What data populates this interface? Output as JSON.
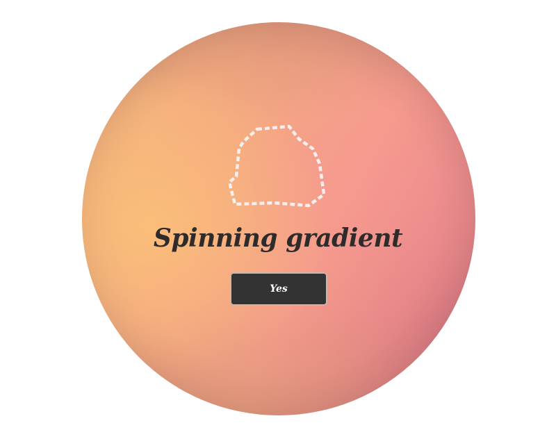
{
  "heading": {
    "text": "Spinning gradient"
  },
  "confirm_button": {
    "label": "Yes"
  },
  "shape": {
    "icon": "dashed-outline-blob-icon",
    "stroke_color": "#f4eeee"
  },
  "theme": {
    "gradient_colors": [
      "#f6b97a",
      "#f4ab80",
      "#f59b8c",
      "#e17f86",
      "#d27684"
    ],
    "button_color": "#333333",
    "text_color": "#2f2b2b"
  }
}
